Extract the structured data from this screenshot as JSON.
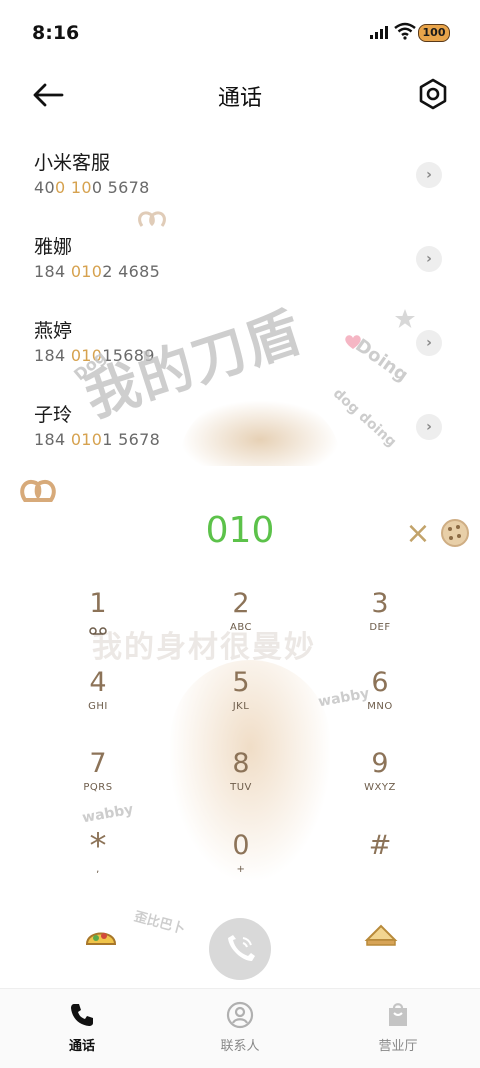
{
  "status": {
    "time": "8:16",
    "battery": "100"
  },
  "header": {
    "title": "通话"
  },
  "contacts": [
    {
      "name": "小米客服",
      "number_parts": [
        "40",
        "0 ",
        "10",
        "0 5678"
      ]
    },
    {
      "name": "雅娜",
      "number_parts": [
        "184 ",
        "010",
        "2 4685",
        ""
      ]
    },
    {
      "name": "燕婷",
      "number_parts": [
        "184 ",
        "010",
        "15689",
        ""
      ]
    },
    {
      "name": "子玲",
      "number_parts": [
        "184 ",
        "010",
        "1 5678",
        ""
      ]
    }
  ],
  "overlay_text": {
    "big": "我的刀盾",
    "tag_left": "Dog",
    "tag_right": "Doing",
    "tag_right2": "dog doing"
  },
  "dialer": {
    "input": "010",
    "keys": [
      {
        "digit": "1",
        "letters": ""
      },
      {
        "digit": "2",
        "letters": "ABC"
      },
      {
        "digit": "3",
        "letters": "DEF"
      },
      {
        "digit": "4",
        "letters": "GHI"
      },
      {
        "digit": "5",
        "letters": "JKL"
      },
      {
        "digit": "6",
        "letters": "MNO"
      },
      {
        "digit": "7",
        "letters": "PQRS"
      },
      {
        "digit": "8",
        "letters": "TUV"
      },
      {
        "digit": "9",
        "letters": "WXYZ"
      },
      {
        "digit": "*",
        "letters": ","
      },
      {
        "digit": "0",
        "letters": "+"
      },
      {
        "digit": "#",
        "letters": ""
      }
    ],
    "watermark": "我的身材很曼妙",
    "tag_wabby_right": "wabby",
    "tag_wabby_left": "wabby",
    "tag_bottom": "歪比巴卜"
  },
  "nav": {
    "items": [
      {
        "label": "通话",
        "active": true
      },
      {
        "label": "联系人",
        "active": false
      },
      {
        "label": "营业厅",
        "active": false
      }
    ]
  },
  "colors": {
    "accent_green": "#5cc24a",
    "highlight": "#d6a24f",
    "key_digit": "#8c7358"
  }
}
